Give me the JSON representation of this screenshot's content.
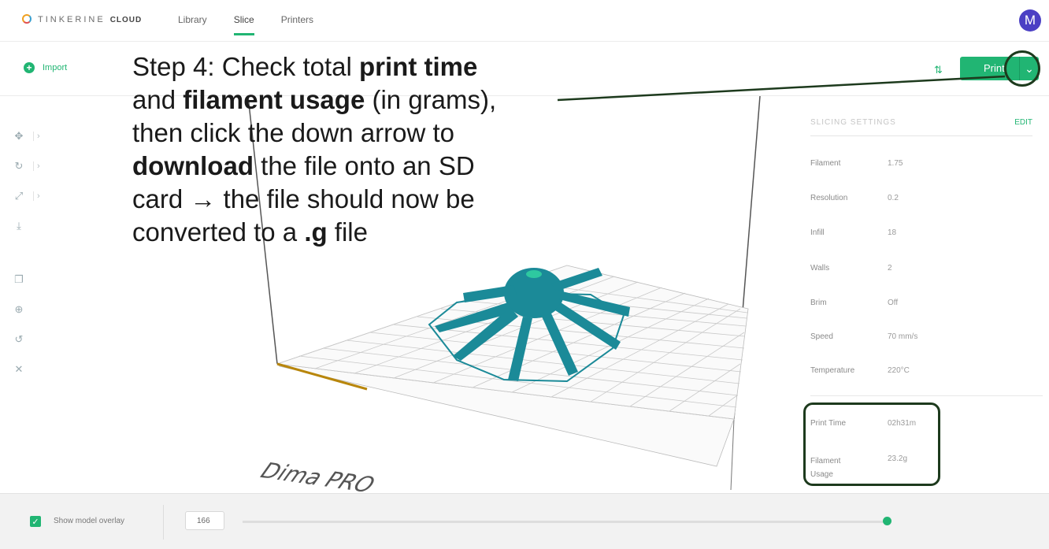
{
  "app": {
    "logo_text": "TINKERINE",
    "logo_suffix": "CLOUD",
    "user_initial": "M"
  },
  "nav": {
    "tabs": [
      {
        "label": "Library",
        "active": false
      },
      {
        "label": "Slice",
        "active": true
      },
      {
        "label": "Printers",
        "active": false
      }
    ]
  },
  "toolbar": {
    "import_label": "Import",
    "print_label": "Print",
    "print_dropdown_icon": "chevron-down-icon"
  },
  "instruction": {
    "line1_pre": "Step 4: Check total ",
    "line1_bold": "print time",
    "line2_pre": "and ",
    "line2_bold": "filament usage",
    "line2_post": " (in grams),",
    "line3": "then click the down arrow to",
    "line4_bold": "download",
    "line4_post": " the file onto an SD",
    "line5": "card → the file should now be",
    "line6_pre": "converted to a ",
    "line6_bold": ".g",
    "line6_post": " file"
  },
  "left_tools": [
    {
      "icon": "move-icon"
    },
    {
      "icon": "rotate-icon"
    },
    {
      "icon": "scale-icon"
    },
    {
      "icon": "drop-to-bed-icon"
    },
    {
      "icon": "duplicate-icon"
    },
    {
      "icon": "center-icon"
    },
    {
      "icon": "reset-icon"
    },
    {
      "icon": "delete-icon"
    }
  ],
  "viewport": {
    "printer_model": "Dima PRO"
  },
  "slicing_settings": {
    "title": "SLICING SETTINGS",
    "edit_label": "EDIT",
    "rows": [
      {
        "label": "Filament",
        "value": "1.75"
      },
      {
        "label": "Resolution",
        "value": "0.2"
      },
      {
        "label": "Infill",
        "value": "18"
      },
      {
        "label": "Walls",
        "value": "2"
      },
      {
        "label": "Brim",
        "value": "Off"
      },
      {
        "label": "Speed",
        "value": "70 mm/s"
      },
      {
        "label": "Temperature",
        "value": "220°C"
      }
    ]
  },
  "print_stats": {
    "print_time_label": "Print Time",
    "print_time_value": "02h31m",
    "filament_usage_label_1": "Filament",
    "filament_usage_label_2": "Usage",
    "filament_usage_value": "23.2g"
  },
  "bottom": {
    "show_overlay_label": "Show model overlay",
    "layer_value": "166",
    "layer_fraction": 1.0
  },
  "colors": {
    "accent": "#21b573",
    "model": "#1b8a98",
    "avatar": "#4b40c4",
    "annotation": "#1d3a1d"
  }
}
